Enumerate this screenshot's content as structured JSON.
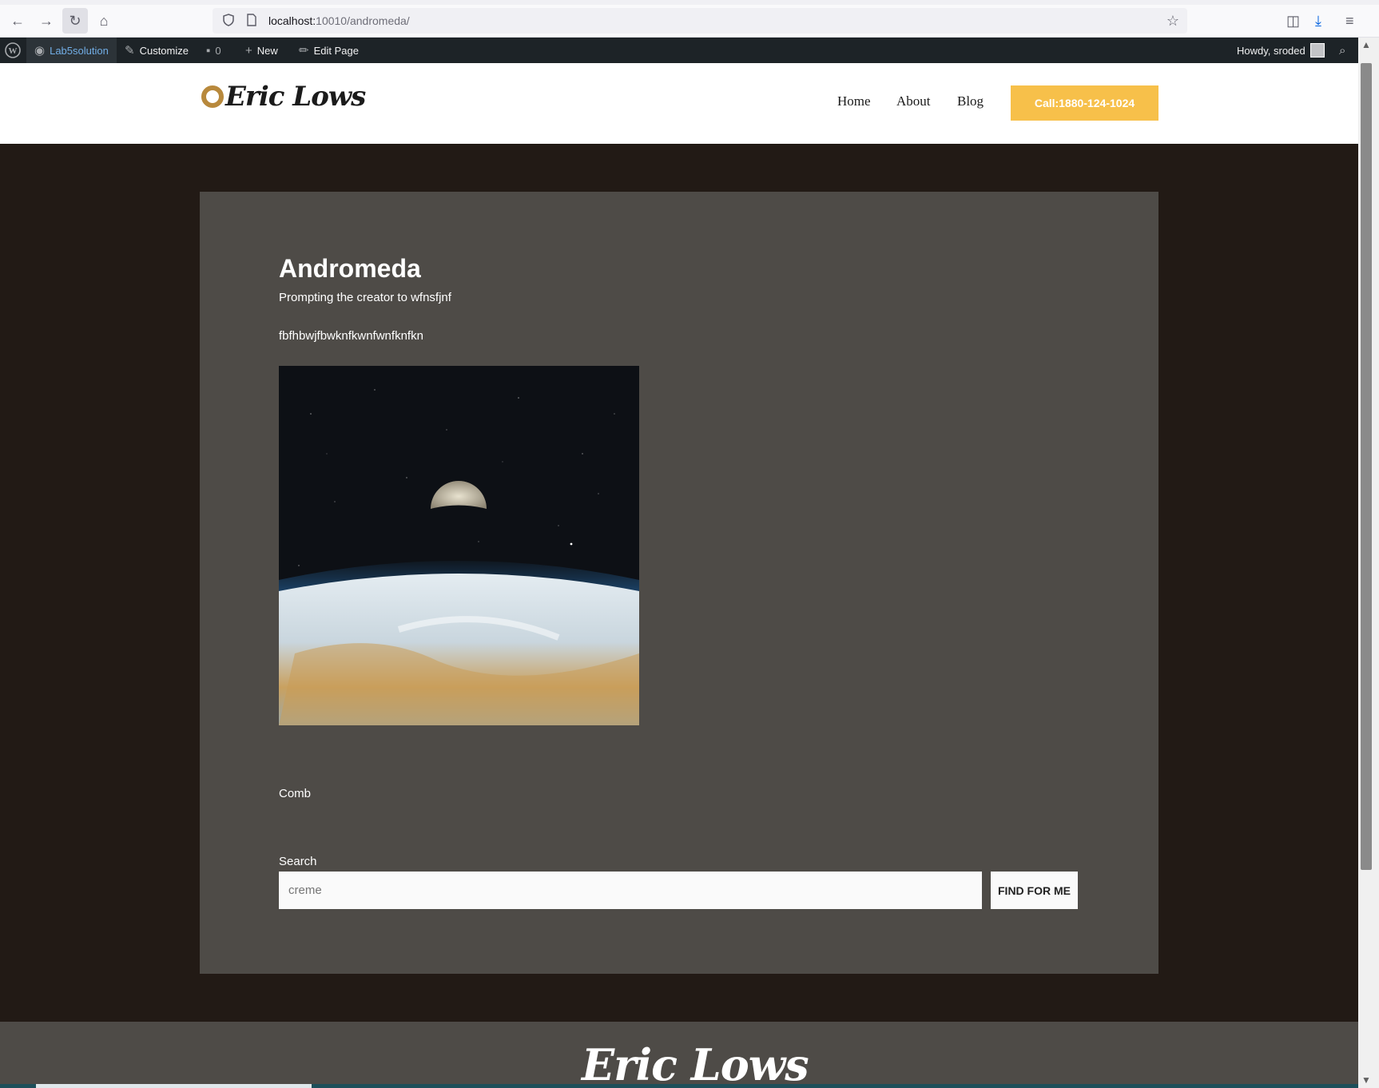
{
  "browser": {
    "url_host": "localhost:",
    "url_path": "10010/andromeda/",
    "back_icon": "←",
    "forward_icon": "→",
    "reload_icon": "↻",
    "home_icon": "⌂",
    "star_icon": "☆",
    "pocket_icon": "◫",
    "download_icon": "⤓",
    "menu_icon": "≡"
  },
  "admin_bar": {
    "site_name": "Lab5solution",
    "customize": "Customize",
    "comments_count": "0",
    "new": "New",
    "edit_page": "Edit Page",
    "howdy": "Howdy, sroded"
  },
  "header": {
    "logo_text": "Eric Lows",
    "nav": [
      "Home",
      "About",
      "Blog"
    ],
    "call_button": "Call:1880-124-1024"
  },
  "post": {
    "title": "Andromeda",
    "paragraph1": "Prompting the creator to wfnsfjnf",
    "paragraph2": "fbfhbwjfbwknfkwnfwnfknfkn",
    "caption": "Comb"
  },
  "search": {
    "label": "Search",
    "placeholder": "creme",
    "button": "FIND FOR ME"
  },
  "footer": {
    "logo_text": "Eric Lows"
  },
  "colors": {
    "accent": "#f7c04a",
    "page_bg": "#221a15",
    "card_bg": "#4e4b47",
    "admin_bar": "#1d2327"
  }
}
